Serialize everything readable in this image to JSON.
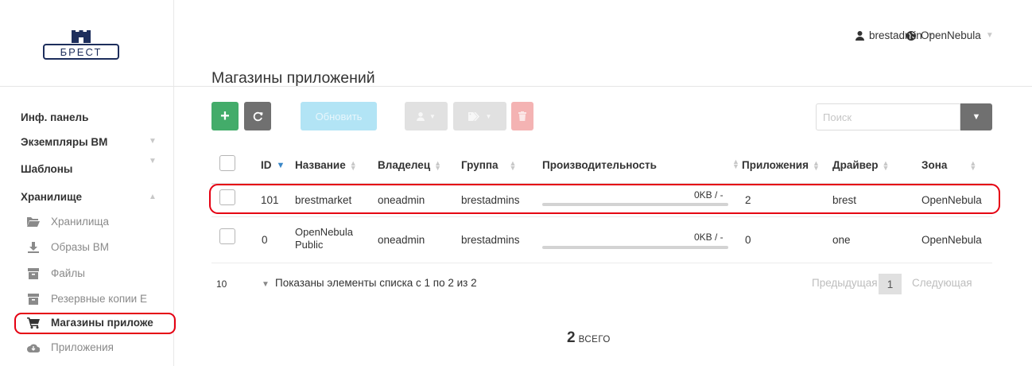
{
  "header": {
    "user": "brestadmin",
    "zone": "OpenNebula",
    "title": "Магазины приложений"
  },
  "logo": {
    "text": "БРЕСТ"
  },
  "sidebar": {
    "items": [
      {
        "label": "Инф. панель"
      },
      {
        "label": "Экземпляры ВМ"
      },
      {
        "label": "Шаблоны"
      },
      {
        "label": "Хранилище"
      }
    ],
    "sub_items": [
      {
        "label": "Хранилища",
        "icon": "folder-open-icon"
      },
      {
        "label": "Образы ВМ",
        "icon": "download-icon"
      },
      {
        "label": "Файлы",
        "icon": "archive-icon"
      },
      {
        "label": "Резервные копии Е",
        "icon": "archive-icon"
      },
      {
        "label": "Магазины приложе",
        "icon": "cart-icon"
      },
      {
        "label": "Приложения",
        "icon": "cloud-icon"
      }
    ]
  },
  "toolbar": {
    "create": "+",
    "update_label": "Обновить",
    "search_placeholder": "Поиск"
  },
  "table": {
    "columns": [
      "ID",
      "Название",
      "Владелец",
      "Группа",
      "Производительность",
      "Приложения",
      "Драйвер",
      "Зона"
    ],
    "rows": [
      {
        "id": "101",
        "name": "brestmarket",
        "owner": "oneadmin",
        "group": "brestadmins",
        "capacity": "0KB / -",
        "capacity_fraction": 0,
        "apps": "2",
        "driver": "brest",
        "zone": "OpenNebula"
      },
      {
        "id": "0",
        "name": "OpenNebula Public",
        "owner": "oneadmin",
        "group": "brestadmins",
        "capacity": "0KB / -",
        "capacity_fraction": 0,
        "apps": "0",
        "driver": "one",
        "zone": "OpenNebula"
      }
    ]
  },
  "footer": {
    "page_size": "10",
    "info": "Показаны элементы списка с 1 по 2 из 2",
    "prev": "Предыдущая",
    "current_page": "1",
    "next": "Следующая",
    "total_count": "2",
    "total_label": "ВСЕГО"
  },
  "colors": {
    "accent_green": "#43ac6a",
    "highlight_red": "#e50012",
    "button_grey": "#707070"
  }
}
